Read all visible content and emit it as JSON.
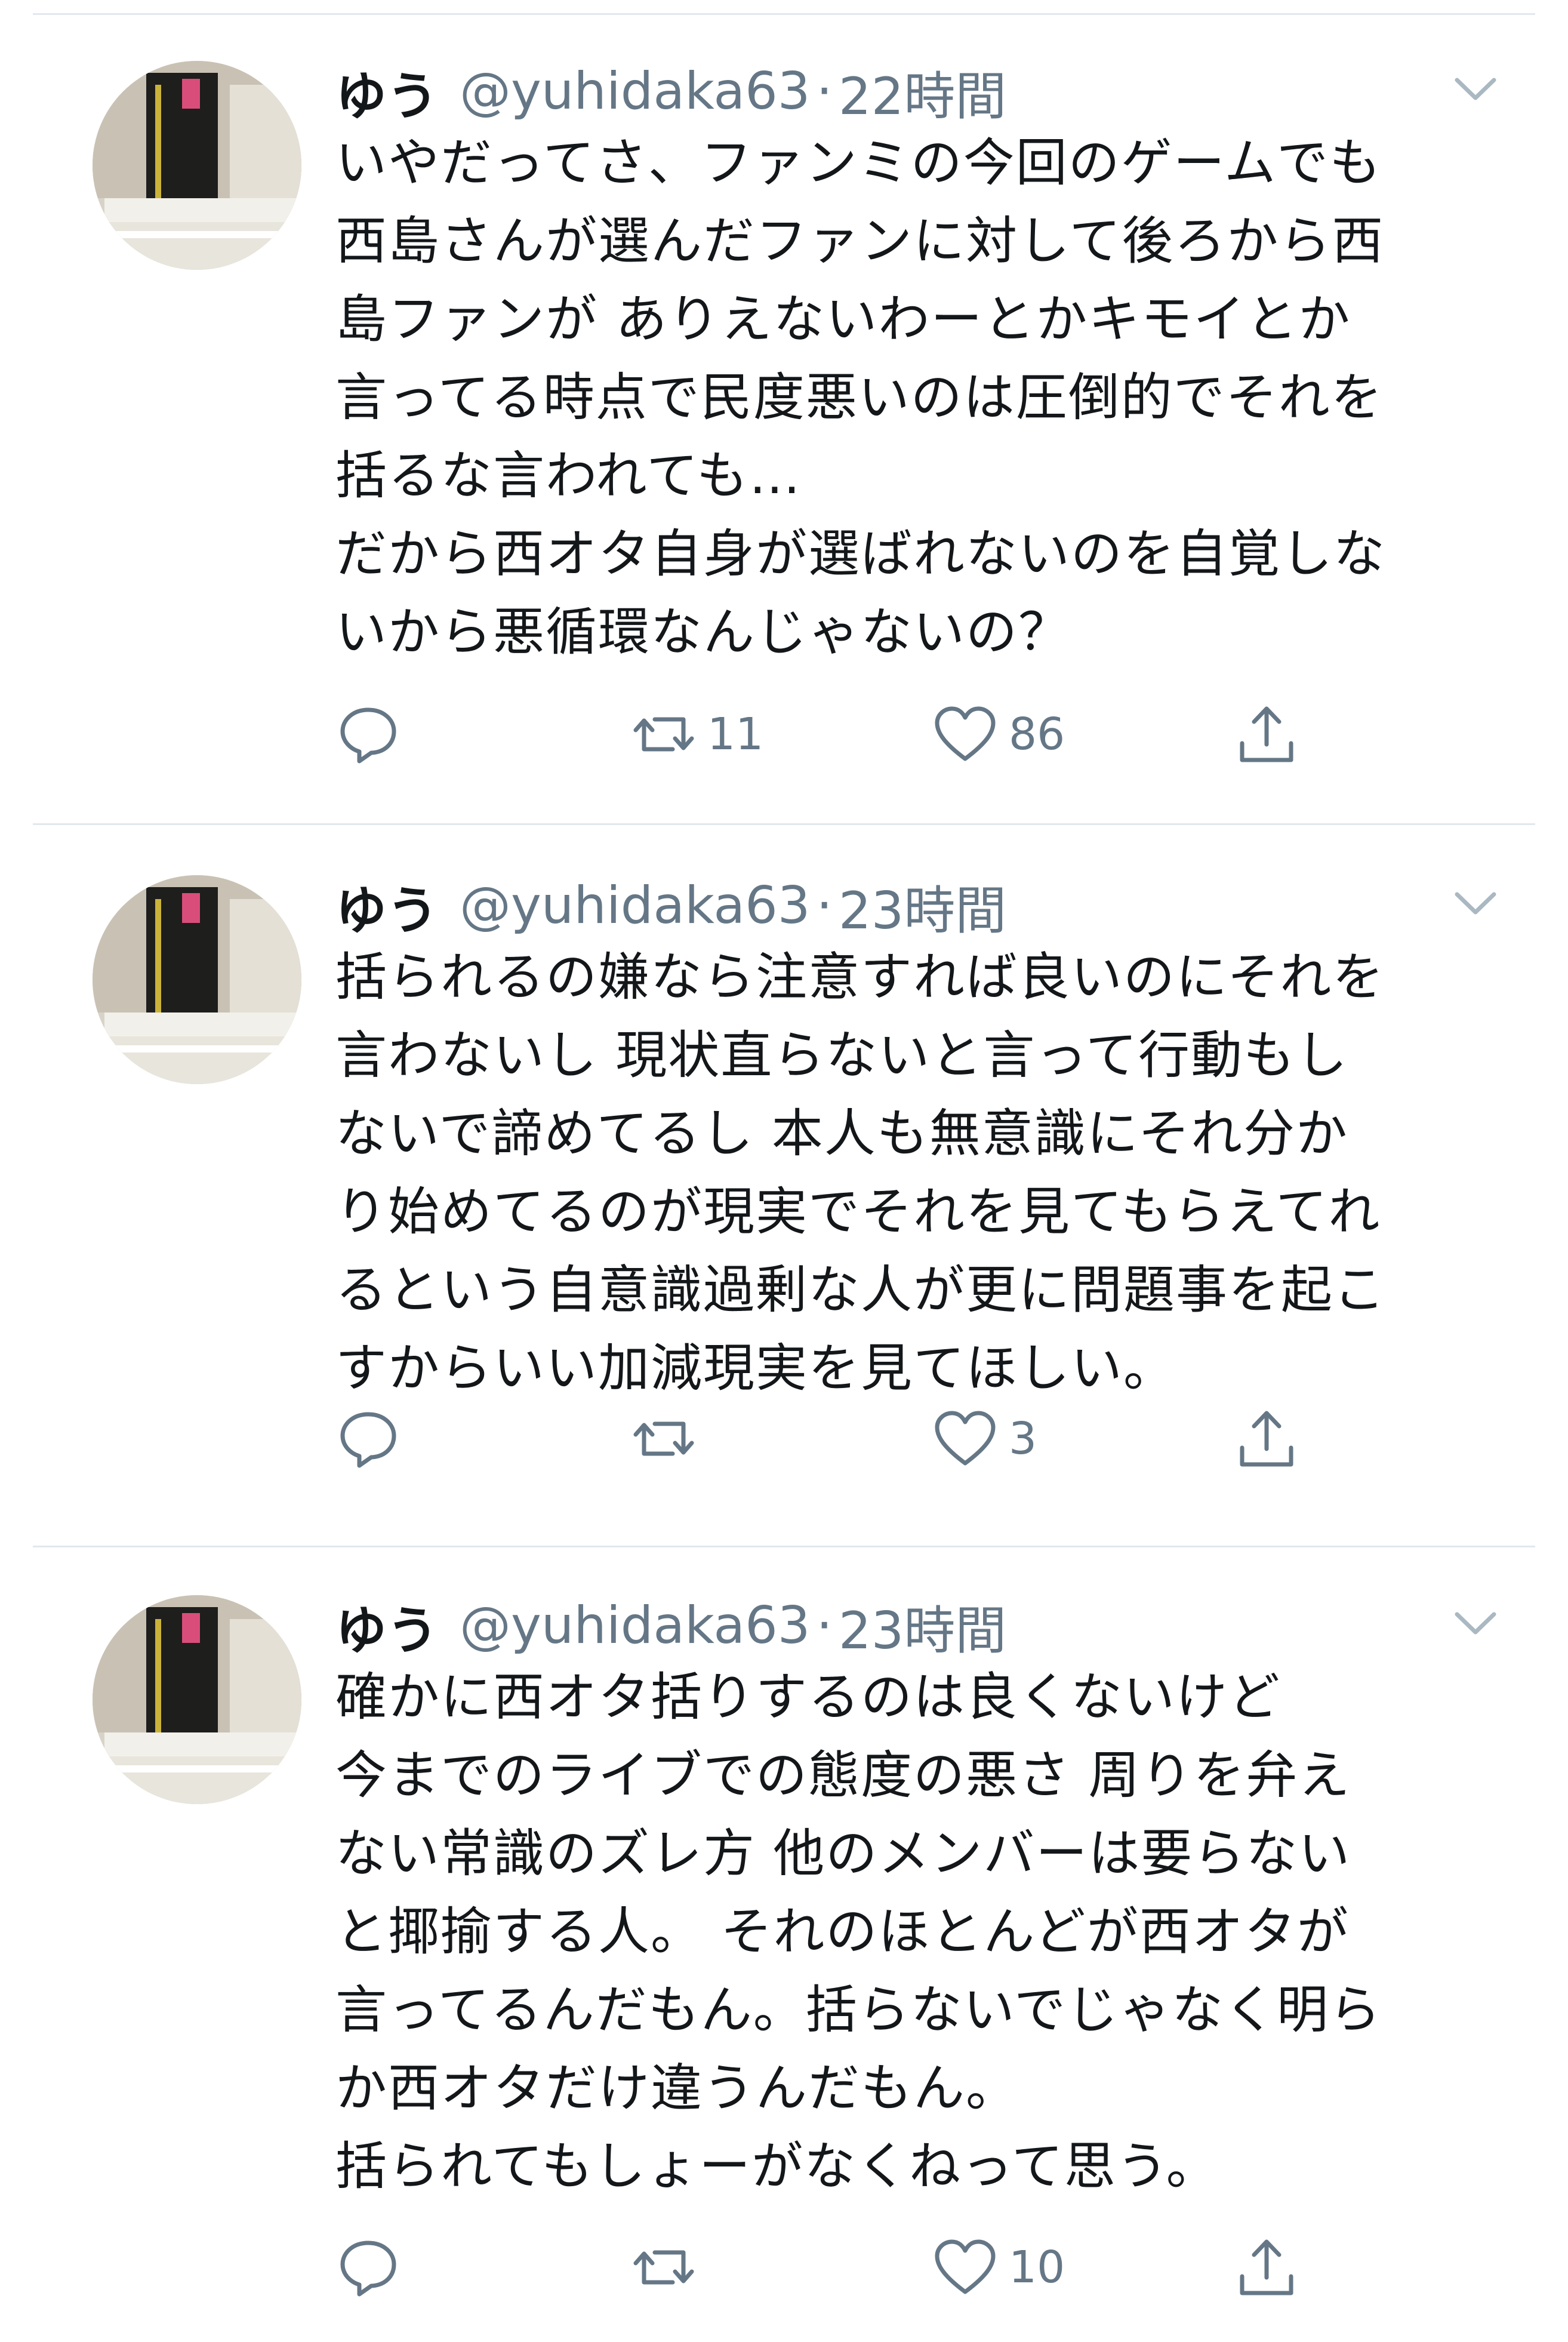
{
  "tweets": [
    {
      "name": "ゆう",
      "handle": "@yuhidaka63",
      "dot": "·",
      "time": "22時間",
      "text": "いやだってさ、ファンミの今回のゲームでも\n西島さんが選んだファンに対して後ろから西\n島ファンが ありえないわーとかキモイとか\n言ってる時点で民度悪いのは圧倒的でそれを\n括るな言われても…\nだから西オタ自身が選ばれないのを自覚しな\nいから悪循環なんじゃないの？",
      "actions": {
        "reply_icon": "reply-icon",
        "retweet_icon": "retweet-icon",
        "retweet_count": "11",
        "like_icon": "heart-icon",
        "like_count": "86",
        "share_icon": "share-icon"
      }
    },
    {
      "name": "ゆう",
      "handle": "@yuhidaka63",
      "dot": "·",
      "time": "23時間",
      "text": "括られるの嫌なら注意すれば良いのにそれを\n言わないし 現状直らないと言って行動もし\nないで諦めてるし 本人も無意識にそれ分か\nり始めてるのが現実でそれを見てもらえてれ\nるという自意識過剰な人が更に問題事を起こ\nすからいい加減現実を見てほしい。",
      "actions": {
        "reply_icon": "reply-icon",
        "retweet_icon": "retweet-icon",
        "retweet_count": "",
        "like_icon": "heart-icon",
        "like_count": "3",
        "share_icon": "share-icon"
      }
    },
    {
      "name": "ゆう",
      "handle": "@yuhidaka63",
      "dot": "·",
      "time": "23時間",
      "text": "確かに西オタ括りするのは良くないけど\n今までのライブでの態度の悪さ 周りを弁え\nない常識のズレ方 他のメンバーは要らない\nと揶揄する人。 それのほとんどが西オタが\n言ってるんだもん。括らないでじゃなく明ら\nか西オタだけ違うんだもん。\n括られてもしょーがなくねって思う。",
      "actions": {
        "reply_icon": "reply-icon",
        "retweet_icon": "retweet-icon",
        "retweet_count": "",
        "like_icon": "heart-icon",
        "like_count": "10",
        "share_icon": "share-icon"
      }
    }
  ],
  "colors": {
    "text": "#14171a",
    "secondary": "#657786",
    "divider": "#e1e8ed",
    "caret": "#aab8c2"
  }
}
